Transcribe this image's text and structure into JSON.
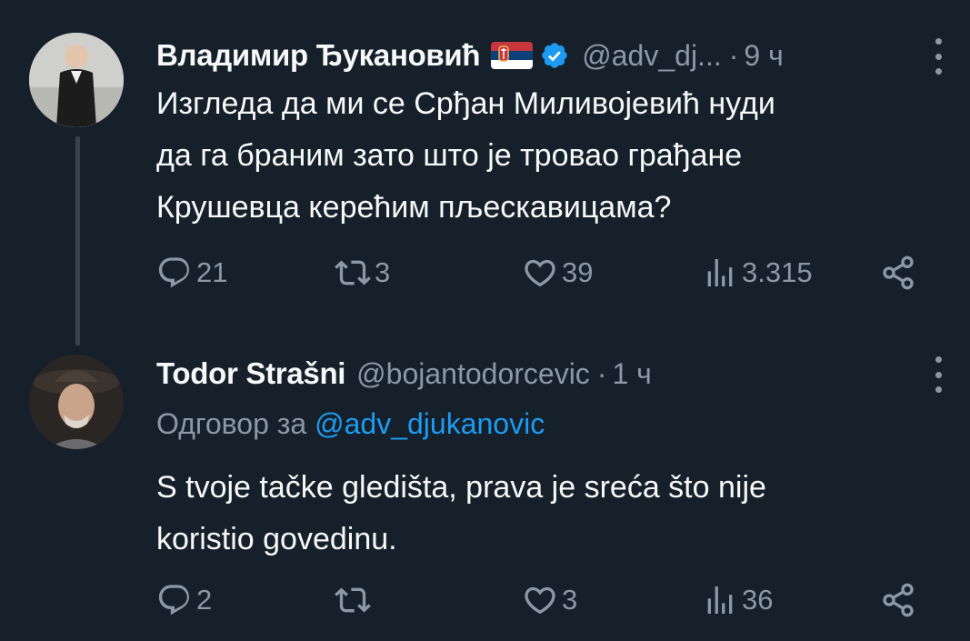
{
  "tweets": [
    {
      "author_name": "Владимир Ђукановић",
      "flag_icon": "serbia-flag-icon",
      "verified_icon": "verified-badge-icon",
      "handle": "@adv_dj...",
      "dot": "·",
      "time": "9 ч",
      "text_lines": [
        "Изгледа да ми се Срђан Миливојевић нуди",
        "да га браним зато што је тровао грађане",
        "Крушевца керећим пљескавицама?"
      ],
      "replies": "21",
      "retweets": "3",
      "likes": "39",
      "views": "3.315"
    },
    {
      "author_name": "Todor Strašni",
      "handle": "@bojantodorcevic",
      "dot": "·",
      "time": "1 ч",
      "reply_to_label": "Одговор за",
      "reply_to_handle": "@adv_djukanovic",
      "text_lines": [
        "S tvoje tačke gledišta, prava je sreća što nije",
        "koristio govedinu."
      ],
      "replies": "2",
      "retweets": "",
      "likes": "3",
      "views": "36"
    }
  ],
  "colors": {
    "background": "#15202b",
    "text": "#f7f9f9",
    "secondary": "#8b98a5",
    "accent": "#1d9bf0"
  }
}
